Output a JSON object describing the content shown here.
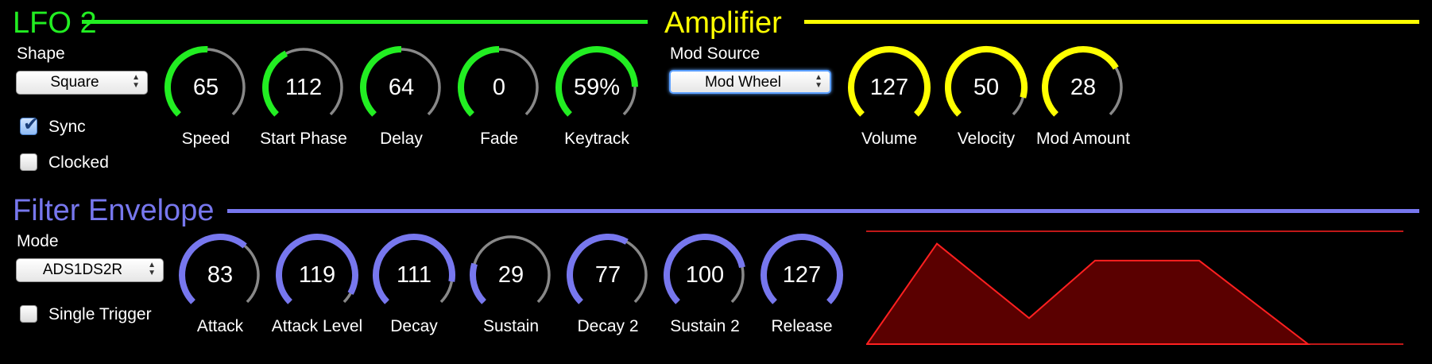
{
  "colors": {
    "lfo": "#22ee22",
    "amp": "#ffff00",
    "filter": "#7777ee",
    "knob_track": "#888888",
    "envelope_line": "#ff2020",
    "envelope_fill": "#5a0000"
  },
  "lfo2": {
    "title": "LFO 2",
    "shape_label": "Shape",
    "shape_value": "Square",
    "sync_label": "Sync",
    "sync_checked": true,
    "clocked_label": "Clocked",
    "clocked_checked": false,
    "knobs": [
      {
        "name": "Speed",
        "value": "65",
        "level": 0.51
      },
      {
        "name": "Start Phase",
        "value": "112",
        "level": 0.4
      },
      {
        "name": "Delay",
        "value": "64",
        "level": 0.5
      },
      {
        "name": "Fade",
        "value": "0",
        "level": 0.5
      },
      {
        "name": "Keytrack",
        "value": "59%",
        "level": 0.83
      }
    ]
  },
  "amplifier": {
    "title": "Amplifier",
    "mod_source_label": "Mod Source",
    "mod_source_value": "Mod Wheel",
    "knobs": [
      {
        "name": "Volume",
        "value": "127",
        "level": 1.0
      },
      {
        "name": "Velocity",
        "value": "50",
        "level": 0.89
      },
      {
        "name": "Mod Amount",
        "value": "28",
        "level": 0.72
      }
    ]
  },
  "filter_envelope": {
    "title": "Filter Envelope",
    "mode_label": "Mode",
    "mode_value": "ADS1DS2R",
    "single_trigger_label": "Single Trigger",
    "single_trigger_checked": false,
    "knobs": [
      {
        "name": "Attack",
        "value": "83",
        "level": 0.65
      },
      {
        "name": "Attack Level",
        "value": "119",
        "level": 0.94
      },
      {
        "name": "Decay",
        "value": "111",
        "level": 0.87
      },
      {
        "name": "Sustain",
        "value": "29",
        "level": 0.23
      },
      {
        "name": "Decay 2",
        "value": "77",
        "level": 0.61
      },
      {
        "name": "Sustain 2",
        "value": "100",
        "level": 0.79
      },
      {
        "name": "Release",
        "value": "127",
        "level": 1.0
      }
    ],
    "envelope_levels": {
      "attack_level": 0.89,
      "decay_level": 0.23,
      "sustain2_level": 0.74
    }
  }
}
